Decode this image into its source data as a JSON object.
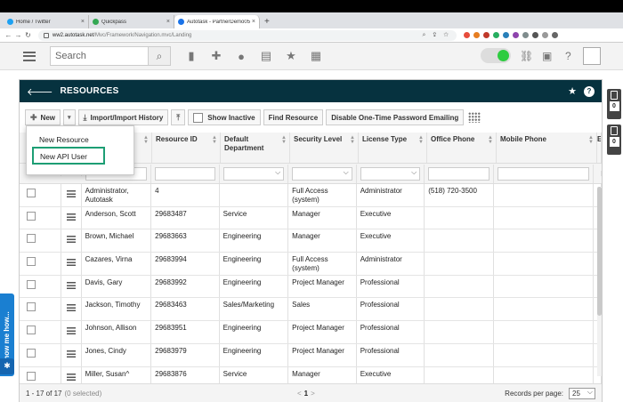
{
  "browser": {
    "tabs": [
      {
        "label": "Home / Twitter",
        "color": "#1da1f2"
      },
      {
        "label": "Quickpass",
        "color": "#34a853"
      },
      {
        "label": "Autotask - PartnerDemo05.16",
        "color": "#1a73e8"
      }
    ],
    "url_host": "ww2.autotask.net",
    "url_path": "/Mvc/Framework/Navigation.mvc/Landing"
  },
  "header": {
    "search_placeholder": "Search"
  },
  "panel": {
    "title": "RESOURCES"
  },
  "toolbar": {
    "new_label": "New",
    "import_label": "Import/Import History",
    "show_inactive_label": "Show Inactive",
    "find_resource_label": "Find Resource",
    "disable_otp_label": "Disable One-Time Password Emailing"
  },
  "new_menu": {
    "item1": "New Resource",
    "item2": "New API User"
  },
  "table": {
    "columns": [
      "Resource ID",
      "Default Department",
      "Security Level",
      "License Type",
      "Office Phone",
      "Mobile Phone",
      "E"
    ],
    "rows": [
      {
        "name": "Administrator, Autotask",
        "id": "4",
        "dept": "",
        "sec": "Full Access (system)",
        "lic": "Administrator",
        "phone": "(518) 720-3500"
      },
      {
        "name": "Anderson, Scott",
        "id": "29683487",
        "dept": "Service",
        "sec": "Manager",
        "lic": "Executive",
        "phone": ""
      },
      {
        "name": "Brown, Michael",
        "id": "29683663",
        "dept": "Engineering",
        "sec": "Manager",
        "lic": "Executive",
        "phone": ""
      },
      {
        "name": "Cazares, Virna",
        "id": "29683994",
        "dept": "Engineering",
        "sec": "Full Access (system)",
        "lic": "Administrator",
        "phone": ""
      },
      {
        "name": "Davis, Gary",
        "id": "29683992",
        "dept": "Engineering",
        "sec": "Project Manager",
        "lic": "Professional",
        "phone": ""
      },
      {
        "name": "Jackson, Timothy",
        "id": "29683463",
        "dept": "Sales/Marketing",
        "sec": "Sales",
        "lic": "Professional",
        "phone": ""
      },
      {
        "name": "Johnson, Allison",
        "id": "29683951",
        "dept": "Engineering",
        "sec": "Project Manager",
        "lic": "Professional",
        "phone": ""
      },
      {
        "name": "Jones, Cindy",
        "id": "29683979",
        "dept": "Engineering",
        "sec": "Project Manager",
        "lic": "Professional",
        "phone": ""
      },
      {
        "name": "Miller, Susan^",
        "id": "29683876",
        "dept": "Service",
        "sec": "Manager",
        "lic": "Executive",
        "phone": ""
      }
    ]
  },
  "footer": {
    "count": "1 - 17 of 17",
    "selected": "(0 selected)",
    "page": "1",
    "records_label": "Records per page:",
    "records_value": "25"
  },
  "side": {
    "count1": "0",
    "count2": "0",
    "show_me": "Show me how..."
  }
}
